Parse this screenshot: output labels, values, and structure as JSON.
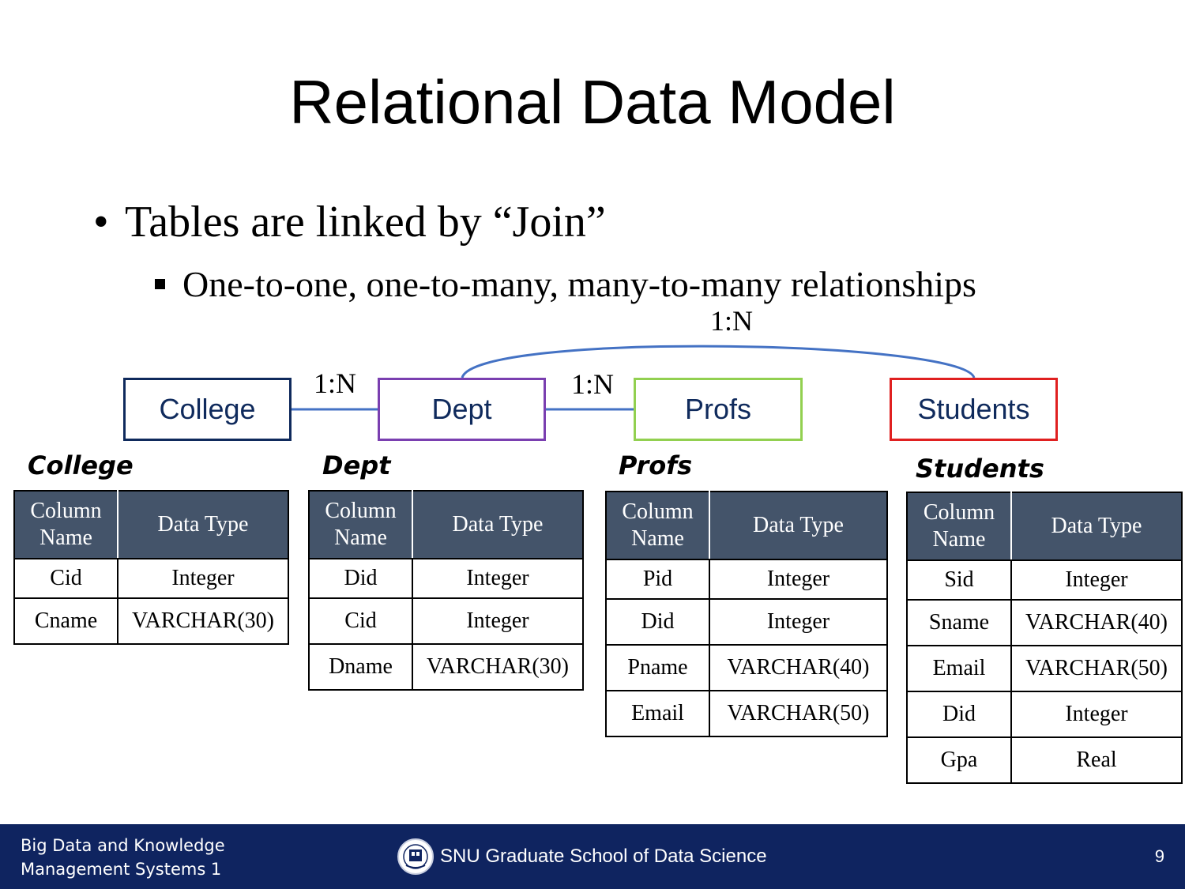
{
  "slide": {
    "title": "Relational Data Model",
    "bullet": "Tables are linked by “Join”",
    "sub_bullet": "One-to-one, one-to-many, many-to-many relationships"
  },
  "diagram": {
    "entities": [
      "College",
      "Dept",
      "Profs",
      "Students"
    ],
    "relationships": [
      {
        "from": "College",
        "to": "Dept",
        "label": "1:N"
      },
      {
        "from": "Dept",
        "to": "Profs",
        "label": "1:N"
      },
      {
        "from": "Dept",
        "to": "Students",
        "label": "1:N"
      }
    ]
  },
  "tables": [
    {
      "name": "College",
      "header": [
        "Column\nName",
        "Data Type"
      ],
      "rows": [
        [
          "Cid",
          "Integer"
        ],
        [
          "Cname",
          "VARCHAR(30)"
        ]
      ]
    },
    {
      "name": "Dept",
      "header": [
        "Column\nName",
        "Data Type"
      ],
      "rows": [
        [
          "Did",
          "Integer"
        ],
        [
          "Cid",
          "Integer"
        ],
        [
          "Dname",
          "VARCHAR(30)"
        ]
      ]
    },
    {
      "name": "Profs",
      "header": [
        "Column\nName",
        "Data Type"
      ],
      "rows": [
        [
          "Pid",
          "Integer"
        ],
        [
          "Did",
          "Integer"
        ],
        [
          "Pname",
          "VARCHAR(40)"
        ],
        [
          "Email",
          "VARCHAR(50)"
        ]
      ]
    },
    {
      "name": "Students",
      "header": [
        "Column\nName",
        "Data Type"
      ],
      "rows": [
        [
          "Sid",
          "Integer"
        ],
        [
          "Sname",
          "VARCHAR(40)"
        ],
        [
          "Email",
          "VARCHAR(50)"
        ],
        [
          "Did",
          "Integer"
        ],
        [
          "Gpa",
          "Real"
        ]
      ]
    }
  ],
  "footer": {
    "course_line1": "Big Data and Knowledge",
    "course_line2": "Management Systems 1",
    "school": "SNU Graduate School of Data Science",
    "page_number": "9",
    "logo_icon": "snu-emblem-icon"
  },
  "colors": {
    "footer_bg": "#0f2460",
    "table_header_bg": "#44546a",
    "link_line": "#4472c4",
    "college_border": "#0f2a5c",
    "dept_border": "#7a3fb0",
    "profs_border": "#92d050",
    "students_border": "#e02020"
  }
}
